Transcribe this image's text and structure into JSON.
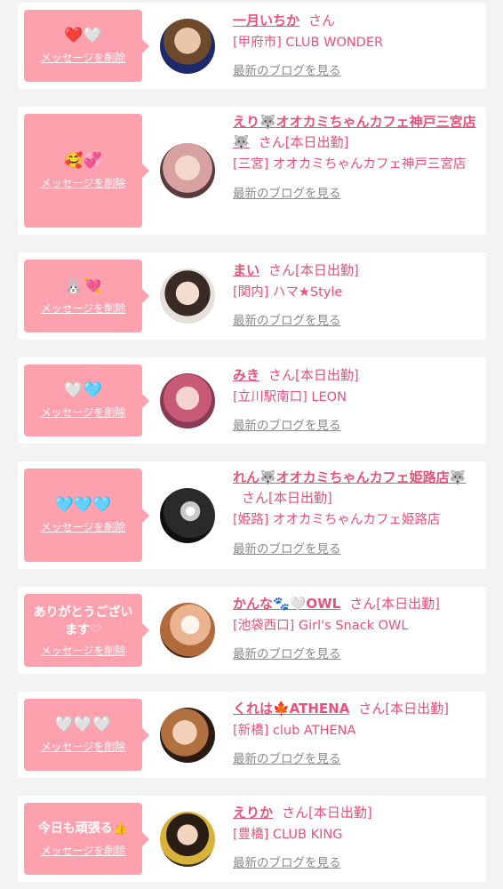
{
  "common": {
    "delete_label": "メッセージを削除",
    "blog_label": "最新のブログを見る",
    "accent_color": "#e8527a",
    "bubble_color": "#fda1ae"
  },
  "entries": [
    {
      "message": "❤️🤍",
      "name": "一月いちか",
      "suffix": "さん",
      "shop": "[甲府市] CLUB WONDER"
    },
    {
      "message": "🥰💞",
      "name": "えり🐺オオカミちゃんカフェ神戸三宮店🐺",
      "suffix": "さん[本日出勤]",
      "shop": "[三宮] オオカミちゃんカフェ神戸三宮店"
    },
    {
      "message": "🐰💘",
      "name": "まい",
      "suffix": "さん[本日出勤]",
      "shop": "[関内] ハマ★Style"
    },
    {
      "message": "🤍🩵",
      "name": "みき",
      "suffix": "さん[本日出勤]",
      "shop": "[立川駅南口] LEON"
    },
    {
      "message": "🩵🩵🩵",
      "name": "れん🐺オオカミちゃんカフェ姫路店🐺",
      "suffix": "さん[本日出勤]",
      "shop": "[姫路] オオカミちゃんカフェ姫路店"
    },
    {
      "message": "ありがとうございます♡",
      "name": "かんな🐾🤍OWL",
      "suffix": "さん[本日出勤]",
      "shop": "[池袋西口] Girl's Snack OWL"
    },
    {
      "message": "🤍🤍🤍",
      "name": "くれは🍁ATHENA",
      "suffix": "さん[本日出勤]",
      "shop": "[新橋] club ATHENA"
    },
    {
      "message": "今日も頑張る👍",
      "name": "えりか",
      "suffix": "さん[本日出勤]",
      "shop": "[豊橋] CLUB KING"
    }
  ]
}
